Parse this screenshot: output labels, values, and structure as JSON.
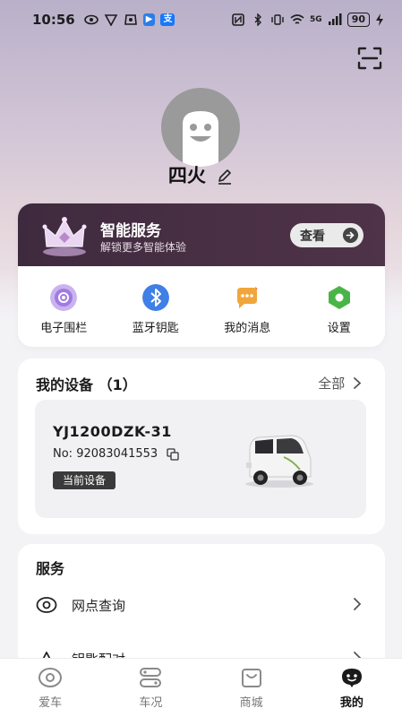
{
  "status_bar": {
    "time": "10:56",
    "network": "5G",
    "battery": "90"
  },
  "profile": {
    "username": "四火"
  },
  "smart_service": {
    "title": "智能服务",
    "subtitle": "解锁更多智能体验",
    "view_label": "查看"
  },
  "quick_actions": [
    {
      "label": "电子围栏",
      "icon": "geofence-icon",
      "color": "#a07be0"
    },
    {
      "label": "蓝牙钥匙",
      "icon": "bluetooth-icon",
      "color": "#3f7fe6"
    },
    {
      "label": "我的消息",
      "icon": "message-icon",
      "color": "#f0a63a"
    },
    {
      "label": "设置",
      "icon": "settings-icon",
      "color": "#49b548"
    }
  ],
  "devices": {
    "title": "我的设备 （1）",
    "all_label": "全部",
    "items": [
      {
        "model": "YJ1200DZK-31",
        "number": "No: 92083041553",
        "badge": "当前设备"
      }
    ]
  },
  "services": {
    "title": "服务",
    "items": [
      {
        "label": "网点查询",
        "icon": "location-icon"
      },
      {
        "label": "钥匙配对",
        "icon": "key-pair-icon"
      }
    ]
  },
  "tabs": [
    {
      "label": "爱车",
      "icon": "car-icon",
      "active": false
    },
    {
      "label": "车况",
      "icon": "vehicle-status-icon",
      "active": false
    },
    {
      "label": "商城",
      "icon": "shop-icon",
      "active": false
    },
    {
      "label": "我的",
      "icon": "profile-icon",
      "active": true
    }
  ],
  "colors": {
    "banner_bg": "#4a3045",
    "accent_dark": "#3a3a3a"
  }
}
